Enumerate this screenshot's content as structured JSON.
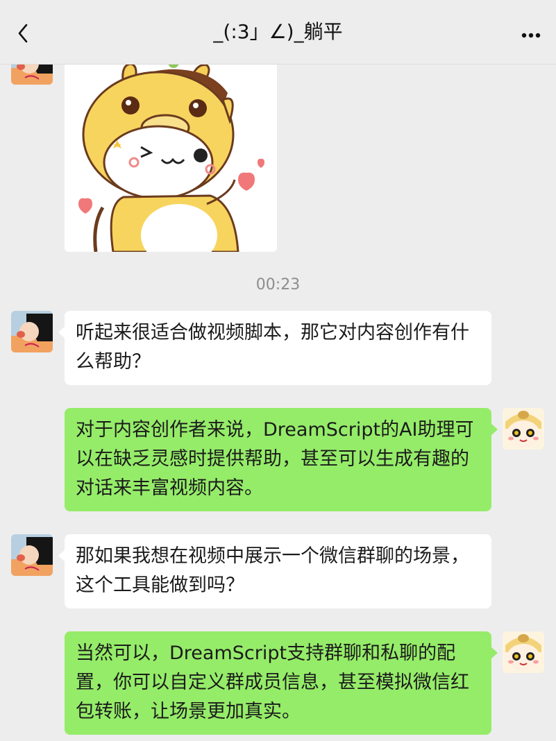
{
  "header": {
    "title": "_(:3」∠)_躺平",
    "back_icon": "chevron-left-icon",
    "more_icon": "more-horizontal-icon"
  },
  "chat": {
    "timestamp": "00:23",
    "messages": [
      {
        "side": "left",
        "text": "听起来很适合做视频脚本，那它对内容创作有什么帮助？"
      },
      {
        "side": "right",
        "text": "对于内容创作者来说，DreamScript的AI助理可以在缺乏灵感时提供帮助，甚至可以生成有趣的对话来丰富视频内容。"
      },
      {
        "side": "left",
        "text": "那如果我想在视频中展示一个微信群聊的场景，这个工具能做到吗？"
      },
      {
        "side": "right",
        "text": "当然可以，DreamScript支持群聊和私聊的配置，你可以自定义群成员信息，甚至模拟微信红包转账，让场景更加真实。"
      }
    ]
  },
  "colors": {
    "background": "#ededed",
    "bubble_left": "#ffffff",
    "bubble_right": "#95ec69",
    "timestamp": "#8d8d8d"
  }
}
